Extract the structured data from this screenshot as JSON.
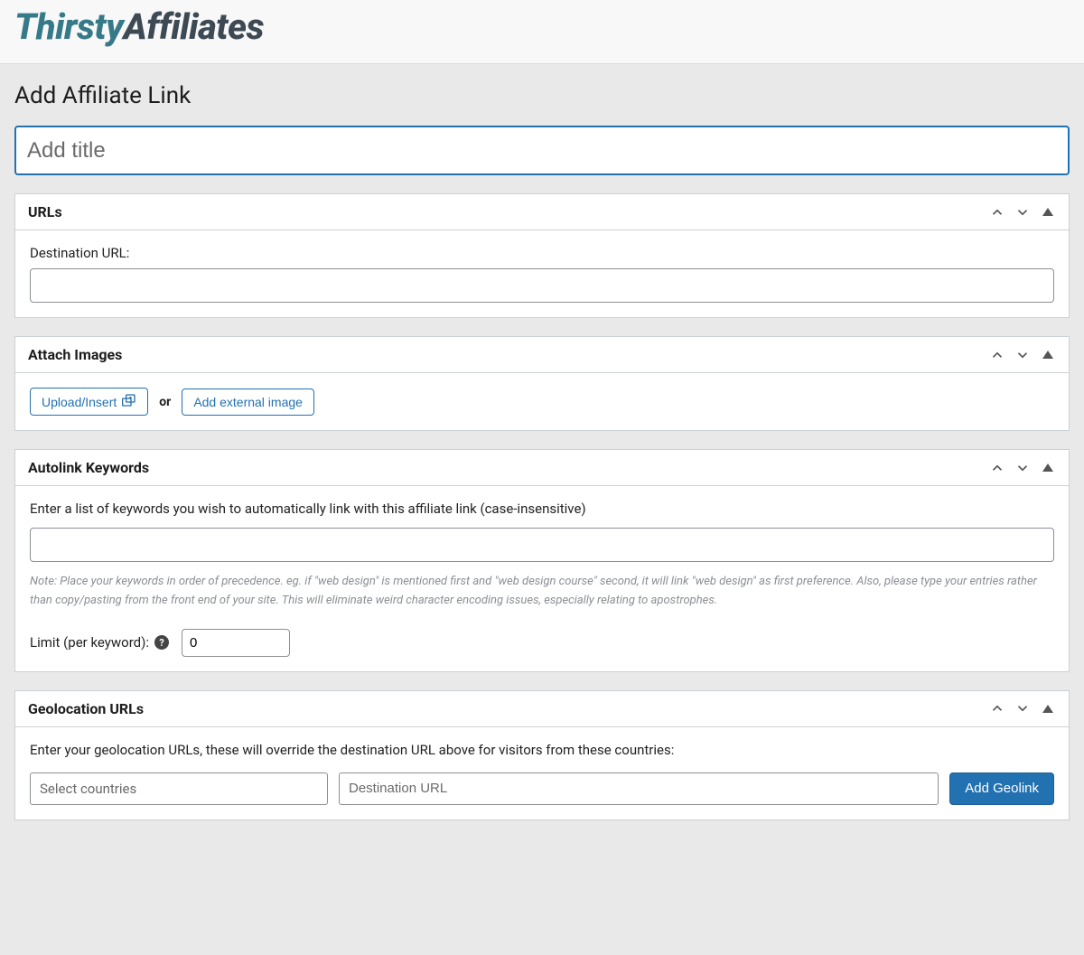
{
  "header": {
    "logo_part1": "Thirsty",
    "logo_part2": "Affiliates"
  },
  "page": {
    "title": "Add Affiliate Link",
    "title_input_placeholder": "Add title",
    "title_input_value": ""
  },
  "urls_box": {
    "title": "URLs",
    "destination_label": "Destination URL:",
    "destination_value": ""
  },
  "attach_box": {
    "title": "Attach Images",
    "upload_label": "Upload/Insert",
    "or_text": "or",
    "external_label": "Add external image"
  },
  "autolink_box": {
    "title": "Autolink Keywords",
    "instruction": "Enter a list of keywords you wish to automatically link with this affiliate link (case-insensitive)",
    "keywords_value": "",
    "note": "Note: Place your keywords in order of precedence. eg. if \"web design\" is mentioned first and \"web design course\" second, it will link \"web design\" as first preference. Also, please type your entries rather than copy/pasting from the front end of your site. This will eliminate weird character encoding issues, especially relating to apostrophes.",
    "limit_label": "Limit (per keyword):",
    "limit_value": "0"
  },
  "geo_box": {
    "title": "Geolocation URLs",
    "instruction": "Enter your geolocation URLs, these will override the destination URL above for visitors from these countries:",
    "select_placeholder": "Select countries",
    "url_placeholder": "Destination URL",
    "add_button": "Add Geolink"
  }
}
